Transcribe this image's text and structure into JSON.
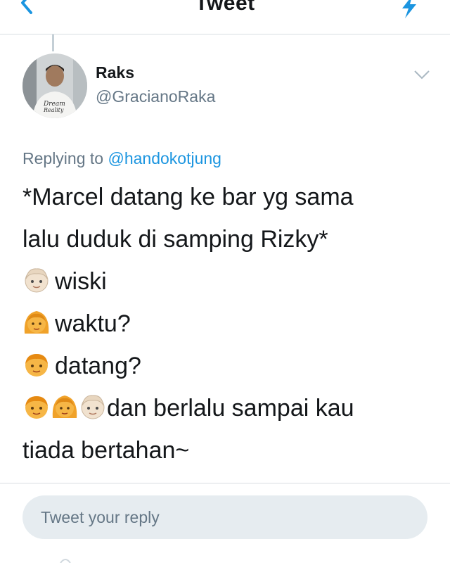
{
  "header": {
    "title": "Tweet"
  },
  "tweet": {
    "author_name": "Raks",
    "author_handle": "@GracianoRaka",
    "replying_prefix": "Replying to",
    "replying_to": "@handokotjung",
    "lines": [
      "*Marcel datang ke bar yg sama",
      "lalu duduk di samping Rizky*",
      "wiski",
      "waktu?",
      "datang?",
      "dan berlalu sampai kau",
      "tiada bertahan~"
    ],
    "avatar_shirt_text": "Dream Reality"
  },
  "reply": {
    "placeholder": "Tweet your reply"
  },
  "colors": {
    "accent": "#1b95e0",
    "secondary_text": "#657786",
    "divider": "#d8dde2",
    "reply_box": "#e6ecf0",
    "emoji_light_skin": "#f1e2cf",
    "emoji_yellow": "#f6a81c"
  }
}
